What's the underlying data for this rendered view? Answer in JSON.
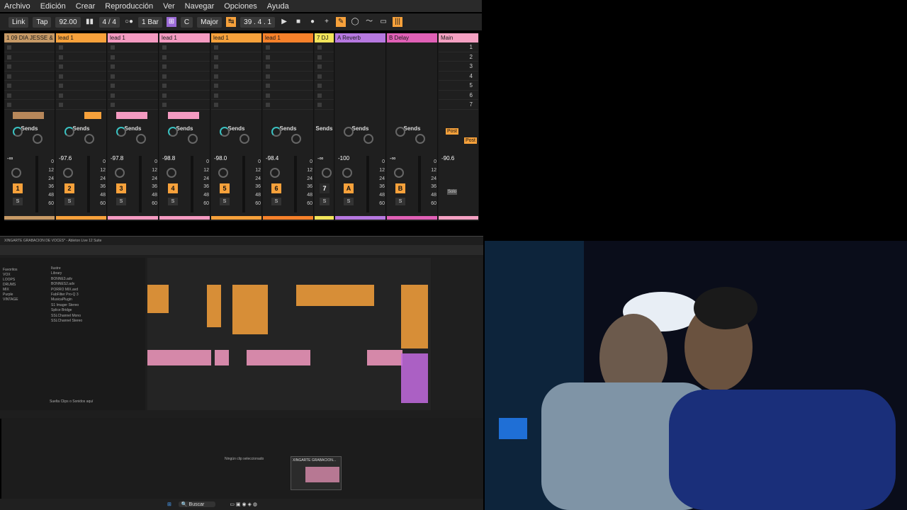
{
  "menu": [
    "Archivo",
    "Edición",
    "Crear",
    "Reproducción",
    "Ver",
    "Navegar",
    "Opciones",
    "Ayuda"
  ],
  "transport": {
    "link": "Link",
    "tap": "Tap",
    "tempo": "92.00",
    "signature": "4 / 4",
    "metro": "1 Bar",
    "key": "C",
    "scale": "Major",
    "position": "39 . 4 . 1"
  },
  "tracks": [
    {
      "name": "1 09 DIA JESSE &",
      "color": "#c79a66",
      "vol": "-∞",
      "num": "1",
      "clip": "#b7875a"
    },
    {
      "name": "lead 1",
      "color": "#f7a13b",
      "vol": "-97.6",
      "num": "2",
      "clip": "#f7a13b"
    },
    {
      "name": "lead 1",
      "color": "#f49ac1",
      "vol": "-97.8",
      "num": "3",
      "clip": "#f49ac1"
    },
    {
      "name": "lead 1",
      "color": "#f49ac1",
      "vol": "-98.8",
      "num": "4",
      "clip": "#f49ac1"
    },
    {
      "name": "lead 1",
      "color": "#f7a13b",
      "vol": "-98.0",
      "num": "5",
      "clip": ""
    },
    {
      "name": "lead 1",
      "color": "#f7812a",
      "vol": "-98.4",
      "num": "6",
      "clip": ""
    },
    {
      "name": "7 DJ",
      "color": "#f2e45a",
      "vol": "-∞",
      "num": "7",
      "clip": ""
    }
  ],
  "returns": [
    {
      "name": "A Reverb",
      "color": "#b678e0",
      "vol": "-100",
      "num": "A"
    },
    {
      "name": "B Delay",
      "color": "#e060b6",
      "vol": "-∞",
      "num": "B"
    }
  ],
  "master": {
    "name": "Main",
    "color": "#f4a0c2",
    "vol": "-90.6",
    "scenes": [
      "1",
      "2",
      "3",
      "4",
      "5",
      "6",
      "7"
    ],
    "post": "Post"
  },
  "labels": {
    "sends": "Sends",
    "send_a": "A",
    "send_b": "B",
    "solo": "S",
    "solo2": "Solo",
    "scale": [
      "0",
      "12",
      "24",
      "36",
      "48",
      "60"
    ]
  },
  "mini": {
    "title": "XINGARTE GRABACION DE VOCES* - Ableton Live 12 Suite",
    "browser_cats": [
      "Favoritos",
      "VOX",
      "LOOPS",
      "DRUMS",
      "MIX",
      "Purple",
      "VINTAGE"
    ],
    "browser_items": [
      "Ilustre",
      "Library",
      "BONNE3.adv",
      "BONNES2.adv",
      "PORRO MIX.avd",
      "FabFilter Pro-Q 3",
      "MusicaPlugin",
      "S1 Imager Stereo",
      "Splice Bridge",
      "SSLChannel Mono",
      "SSLChannel Stereo"
    ],
    "drop": "Suelta Clips o Sonidos aquí",
    "noclip": "Ningún clip seleccionado"
  },
  "taskbar": {
    "search": "Buscar",
    "thumb": "XINGARTE GRABACION..."
  }
}
